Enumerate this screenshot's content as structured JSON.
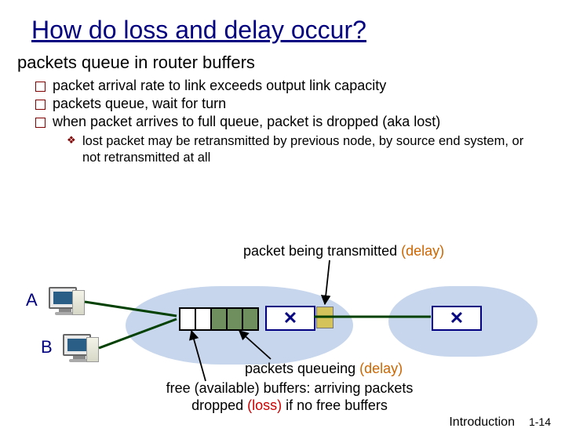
{
  "title": "How do loss and delay occur?",
  "subtitle": "packets queue in router buffers",
  "bullets": [
    "packet arrival rate to link exceeds output link capacity",
    "packets queue, wait for turn",
    "when packet arrives to full queue, packet is dropped (aka lost)"
  ],
  "subbullet": "lost packet may be retransmitted by previous node, by source end system, or not retransmitted at all",
  "ann_transmit_prefix": "packet being transmitted ",
  "ann_transmit_delay": "(delay)",
  "ann_queue_prefix": "packets queueing ",
  "ann_queue_delay": "(delay)",
  "ann_free_line1a": "free (available) buffers: arriving packets",
  "ann_free_line2a": "dropped ",
  "ann_free_loss": "(loss)",
  "ann_free_line2b": " if no free buffers",
  "label_a": "A",
  "label_b": "B",
  "footer_chapter": "Introduction",
  "footer_page": "1-14"
}
